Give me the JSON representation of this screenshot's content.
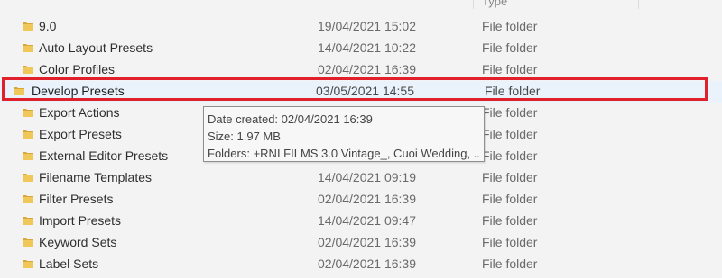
{
  "header": {
    "type_fragment": "Type"
  },
  "rows": [
    {
      "name": "9.0",
      "date": "19/04/2021 15:02",
      "type": "File folder",
      "icon": "folder-icon"
    },
    {
      "name": "Auto Layout Presets",
      "date": "14/04/2021 10:22",
      "type": "File folder",
      "icon": "folder-icon"
    },
    {
      "name": "Color Profiles",
      "date": "02/04/2021 16:39",
      "type": "File folder",
      "icon": "folder-icon"
    },
    {
      "name": "Develop Presets",
      "date": "03/05/2021 14:55",
      "type": "File folder",
      "icon": "folder-icon",
      "selected": true
    },
    {
      "name": "Export Actions",
      "date": "",
      "type": "File folder",
      "icon": "folder-icon"
    },
    {
      "name": "Export Presets",
      "date": "",
      "type": "File folder",
      "icon": "folder-icon"
    },
    {
      "name": "External Editor Presets",
      "date": "",
      "type": "File folder",
      "icon": "folder-icon"
    },
    {
      "name": "Filename Templates",
      "date": "14/04/2021 09:19",
      "type": "File folder",
      "icon": "folder-icon"
    },
    {
      "name": "Filter Presets",
      "date": "02/04/2021 16:39",
      "type": "File folder",
      "icon": "folder-icon"
    },
    {
      "name": "Import Presets",
      "date": "14/04/2021 09:47",
      "type": "File folder",
      "icon": "folder-icon"
    },
    {
      "name": "Keyword Sets",
      "date": "02/04/2021 16:39",
      "type": "File folder",
      "icon": "folder-icon"
    },
    {
      "name": "Label Sets",
      "date": "02/04/2021 16:39",
      "type": "File folder",
      "icon": "folder-icon"
    }
  ],
  "tooltip": {
    "date_created": "Date created: 02/04/2021 16:39",
    "size": "Size: 1.97 MB",
    "folders": "Folders: +RNI FILMS 3.0 Vintage_, Cuoi Wedding, ..."
  },
  "colors": {
    "highlight_border": "#e0212b",
    "selected_row": "#eaf3fc",
    "folder_yellow": "#e8b84a"
  }
}
